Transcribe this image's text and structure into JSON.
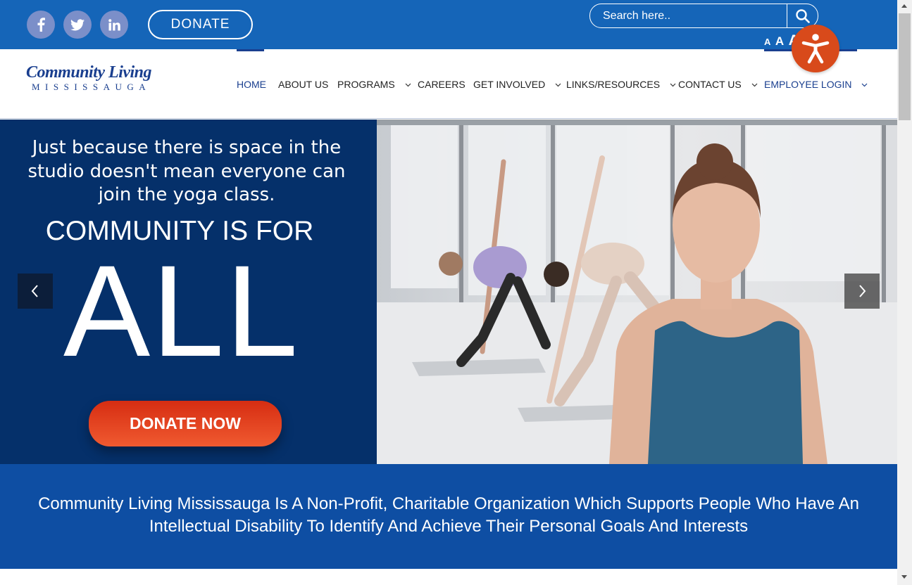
{
  "topbar": {
    "social": [
      {
        "icon": "facebook-icon",
        "label": "f"
      },
      {
        "icon": "twitter-icon",
        "label": ""
      },
      {
        "icon": "linkedin-icon",
        "label": "in"
      }
    ],
    "donate_label": "DONATE",
    "search_placeholder": "Search here..",
    "font_sizes": [
      "A",
      "A",
      "A"
    ]
  },
  "logo": {
    "line1": "Community Living",
    "line2": "MISSISSAUGA"
  },
  "nav": {
    "items": [
      {
        "label": "HOME",
        "active": true
      },
      {
        "label": "ABOUT US"
      },
      {
        "label": "PROGRAMS",
        "dropdown": true
      },
      {
        "label": "CAREERS"
      },
      {
        "label": "GET INVOLVED",
        "dropdown": true
      },
      {
        "label": "LINKS/RESOURCES",
        "dropdown": true
      },
      {
        "label": "CONTACT US",
        "dropdown": true
      },
      {
        "label": "EMPLOYEE LOGIN",
        "dropdown": true
      }
    ]
  },
  "hero": {
    "tagline": "Just because there is space in the studio doesn't mean everyone can join the yoga class.",
    "title": "COMMUNITY IS FOR",
    "big": "ALL",
    "cta": "DONATE NOW"
  },
  "mission": {
    "text": "Community Living Mississauga Is A Non-Profit, Charitable Organization Which Supports People Who Have An Intellectual Disability To Identify And Achieve Their Personal Goals And Interests"
  },
  "colors": {
    "topbar": "#1565b8",
    "hero_panel": "#05306a",
    "mission_band": "#0e4ea3",
    "cta": "#e8401c",
    "accessibility": "#d84a1b"
  }
}
